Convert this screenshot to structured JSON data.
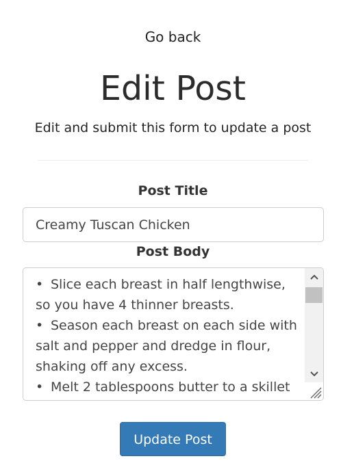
{
  "nav": {
    "go_back": "Go back"
  },
  "header": {
    "title": "Edit Post",
    "subtitle": "Edit and submit this form to update a post"
  },
  "form": {
    "title_label": "Post Title",
    "title_value": "Creamy Tuscan Chicken",
    "body_label": "Post Body",
    "body_lines": [
      "Slice each breast in half lengthwise, so you have 4 thinner breasts.",
      "Season each breast on each side with salt and pepper and dredge in flour, shaking off any excess.",
      "Melt 2 tablespoons butter to a skillet"
    ],
    "submit_label": "Update Post"
  },
  "icons": {
    "bullet": "•",
    "scroll_up": "chevron-up-icon",
    "scroll_down": "chevron-down-icon",
    "resize": "resize-grip-icon"
  },
  "colors": {
    "button_bg": "#337ab7",
    "button_text": "#ffffff",
    "text": "#333333",
    "border": "#cccccc"
  }
}
